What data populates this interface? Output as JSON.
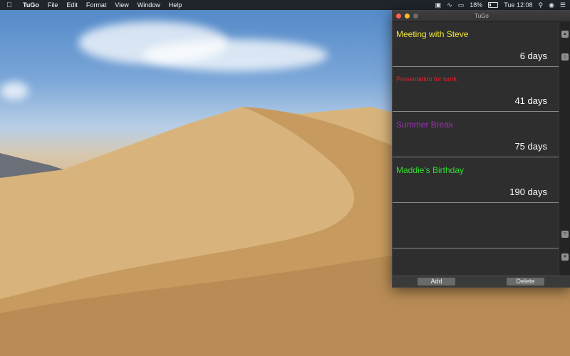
{
  "menubar": {
    "app_name": "TuGo",
    "menus": [
      "File",
      "Edit",
      "Format",
      "View",
      "Window",
      "Help"
    ],
    "battery_percent": "18%",
    "clock": "Tue 12:08"
  },
  "window": {
    "title": "TuGo",
    "events": [
      {
        "title": "Meeting with Steve",
        "days": "6 days",
        "color": "#f2e53a"
      },
      {
        "title": "Presentation for work",
        "days": "41 days",
        "color": "#e8202a"
      },
      {
        "title": "Summer Break",
        "days": "75 days",
        "color": "#9b2fb3"
      },
      {
        "title": "Maddie's Birthday",
        "days": "190 days",
        "color": "#33dd33"
      }
    ],
    "add_label": "Add",
    "delete_label": "Delete"
  },
  "colors": {
    "window_bg": "#2b2b2b",
    "divider": "#8a8a8a"
  }
}
